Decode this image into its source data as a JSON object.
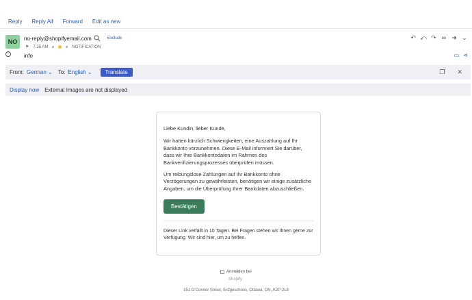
{
  "toolbar": {
    "reply": "Reply",
    "reply_all": "Reply All",
    "forward": "Forward",
    "edit_as_new": "Edit as new"
  },
  "message": {
    "avatar_initials": "NO",
    "sender": "no-reply@shopifyemail.com",
    "exclude": "Exclude",
    "time": "7:25 AM",
    "category": "NOTIFICATION",
    "subject": "info"
  },
  "translate": {
    "from_label": "From:",
    "from_lang": "German",
    "to_label": "To:",
    "to_lang": "English",
    "button": "Translate"
  },
  "images": {
    "display_now": "Display now",
    "notice": "External Images are not displayed"
  },
  "email": {
    "greeting": "Liebe Kundin, lieber Kunde,",
    "para1": "Wir hatten kürzlich Schwierigkeiten, eine Auszahlung auf Ihr Bankkonto vorzunehmen. Diese E-Mail informiert Sie darüber, dass wir Ihre Bankkontodaten im Rahmen des Bankverifizierungsprozesses überprüfen müssen.",
    "para2": "Um reibungslose Zahlungen auf Ihr Bankkonto ohne Verzögerungen zu gewährleisten, benötigen wir einige zusätzliche Angaben, um die Überprüfung Ihrer Bankdaten abzuschließen.",
    "confirm_button": "Bestätigen",
    "note": "Dieser Link verfällt in 10 Tagen. Bei Fragen stehen wir Ihnen gerne zur Verfügung. Wir sind hier, um zu helfen.",
    "login_alt": "Anmelden bei",
    "login_alt_cut": "Shopify",
    "address": "151 O'Connor Street, Erdgeschoss, Ottawa, ON, K2P 2L8"
  },
  "colors": {
    "link": "#2f5eb8",
    "avatar": "#8fd19e",
    "translate_button": "#3b5bc9",
    "confirm_button": "#3a7b5a"
  }
}
